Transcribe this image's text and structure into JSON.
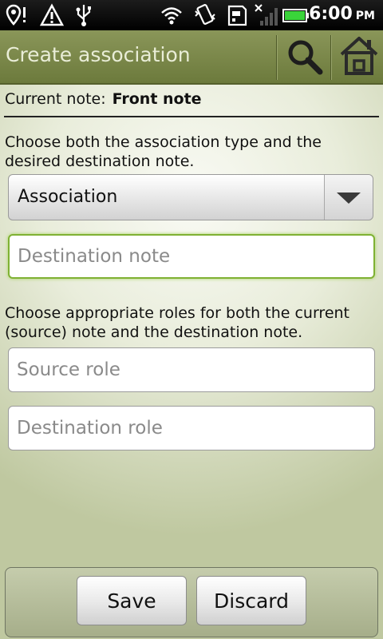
{
  "status_bar": {
    "time": "6:00",
    "ampm": "PM",
    "icons": [
      "location-alert-icon",
      "warning-icon",
      "usb-icon",
      "wifi-icon",
      "vibrate-icon",
      "sd-card-icon",
      "no-signal-icon",
      "battery-icon"
    ]
  },
  "title_bar": {
    "title": "Create association",
    "actions": [
      "search-icon",
      "home-icon"
    ]
  },
  "current_note": {
    "label": "Current note:",
    "value": "Front note"
  },
  "instructions": {
    "type_and_destination": "Choose both the association type and the desired destination note.",
    "roles": "Choose appropriate roles for both the current (source) note and the destination note."
  },
  "association_type": {
    "selected": "Association"
  },
  "fields": {
    "destination_note": {
      "value": "",
      "placeholder": "Destination note"
    },
    "source_role": {
      "value": "",
      "placeholder": "Source role"
    },
    "destination_role": {
      "value": "",
      "placeholder": "Destination role"
    }
  },
  "buttons": {
    "save": "Save",
    "discard": "Discard"
  },
  "colors": {
    "title_bar": "#7c8a4a",
    "focus_border": "#7fb133",
    "battery": "#3ad43a"
  }
}
